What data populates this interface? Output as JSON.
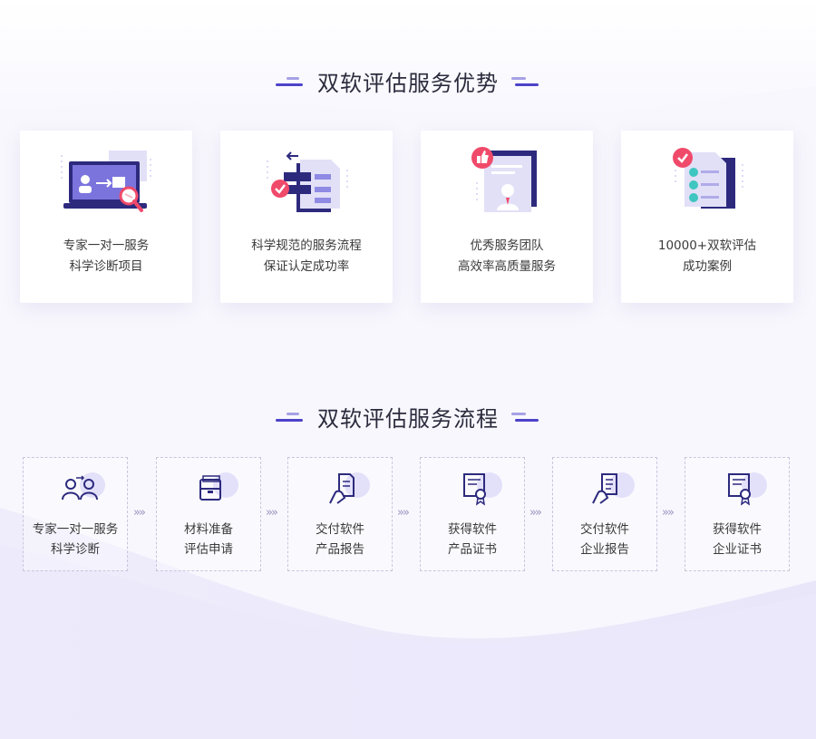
{
  "colors": {
    "accent": "#4d43c9",
    "light_accent": "#a6a1e6",
    "pink": "#f04a6a",
    "bg": "#f7f6fd"
  },
  "advantages": {
    "title": "双软评估服务优势",
    "cards": [
      {
        "icon": "laptop-consultation-icon",
        "line1": "专家一对一服务",
        "line2": "科学诊断项目"
      },
      {
        "icon": "process-document-icon",
        "line1": "科学规范的服务流程",
        "line2": "保证认定成功率"
      },
      {
        "icon": "team-thumbs-up-icon",
        "line1": "优秀服务团队",
        "line2": "高效率高质量服务"
      },
      {
        "icon": "checklist-icon",
        "line1": "10000+双软评估",
        "line2": "成功案例"
      }
    ]
  },
  "process": {
    "title": "双软评估服务流程",
    "arrow": "»»",
    "steps": [
      {
        "icon": "people-exchange-icon",
        "line1": "专家一对一服务",
        "line2": "科学诊断"
      },
      {
        "icon": "folder-materials-icon",
        "line1": "材料准备",
        "line2": "评估申请"
      },
      {
        "icon": "hand-document-icon",
        "line1": "交付软件",
        "line2": "产品报告"
      },
      {
        "icon": "certificate-icon",
        "line1": "获得软件",
        "line2": "产品证书"
      },
      {
        "icon": "hand-report-icon",
        "line1": "交付软件",
        "line2": "企业报告"
      },
      {
        "icon": "certificate-icon",
        "line1": "获得软件",
        "line2": "企业证书"
      }
    ]
  }
}
